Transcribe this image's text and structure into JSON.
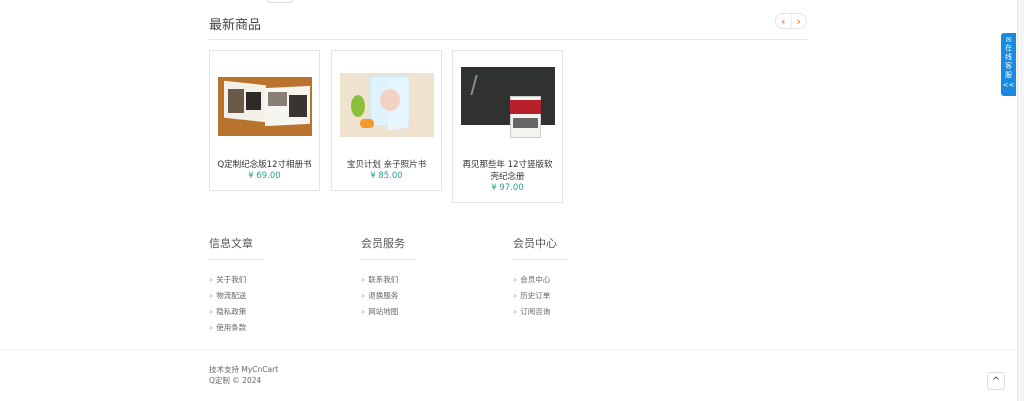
{
  "section": {
    "title": "最新商品",
    "prev": "‹",
    "next": "›"
  },
  "products": [
    {
      "name": "Q定制纪念版12寸相册书",
      "price": "¥ 69.00"
    },
    {
      "name": "宝贝计划 亲子照片书",
      "price": "¥ 85.00"
    },
    {
      "name": "再见那些年 12寸竖版软壳纪念册",
      "price": "¥ 97.00"
    }
  ],
  "footer": {
    "columns": [
      {
        "title": "信息文章",
        "links": [
          "关于我们",
          "物流配送",
          "隐私政策",
          "使用条款"
        ]
      },
      {
        "title": "会员服务",
        "links": [
          "联系我们",
          "退换服务",
          "网站地图"
        ]
      },
      {
        "title": "会员中心",
        "links": [
          "会员中心",
          "历史订单",
          "订阅咨询"
        ]
      }
    ],
    "credit_line1": "技术支持 MyCnCart",
    "credit_line2": "Q定制 © 2024"
  },
  "chat_widget": {
    "label": "在线客服",
    "collapse": "<<"
  },
  "back_to_top": "^",
  "colors": {
    "price": "#2aa090",
    "accent": "#e8701a",
    "chat": "#1a8ae0"
  }
}
